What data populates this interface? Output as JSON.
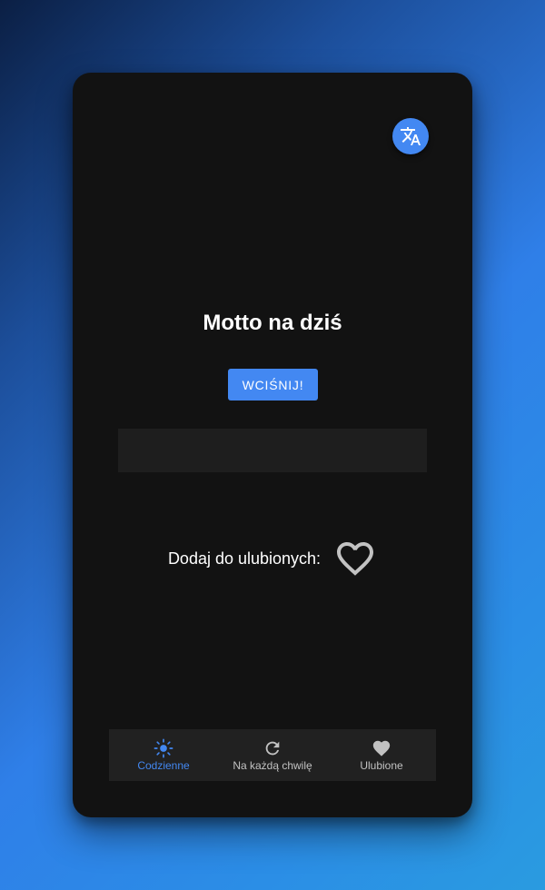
{
  "colors": {
    "accent": "#4388f2",
    "card_background": "#121212",
    "nav_background": "#212121",
    "inactive": "#c2c2c2"
  },
  "header": {
    "translate_icon": "translate-icon"
  },
  "main": {
    "title": "Motto na dziś",
    "press_button_label": "WCIŚNIJ!",
    "motto_text": "",
    "favorite_label": "Dodaj do ulubionych:",
    "favorite_icon": "heart-outline-icon",
    "favorite_active": false
  },
  "nav": {
    "items": [
      {
        "label": "Codzienne",
        "icon": "sun-icon",
        "active": true
      },
      {
        "label": "Na każdą chwilę",
        "icon": "refresh-icon",
        "active": false
      },
      {
        "label": "Ulubione",
        "icon": "heart-icon",
        "active": false
      }
    ]
  }
}
